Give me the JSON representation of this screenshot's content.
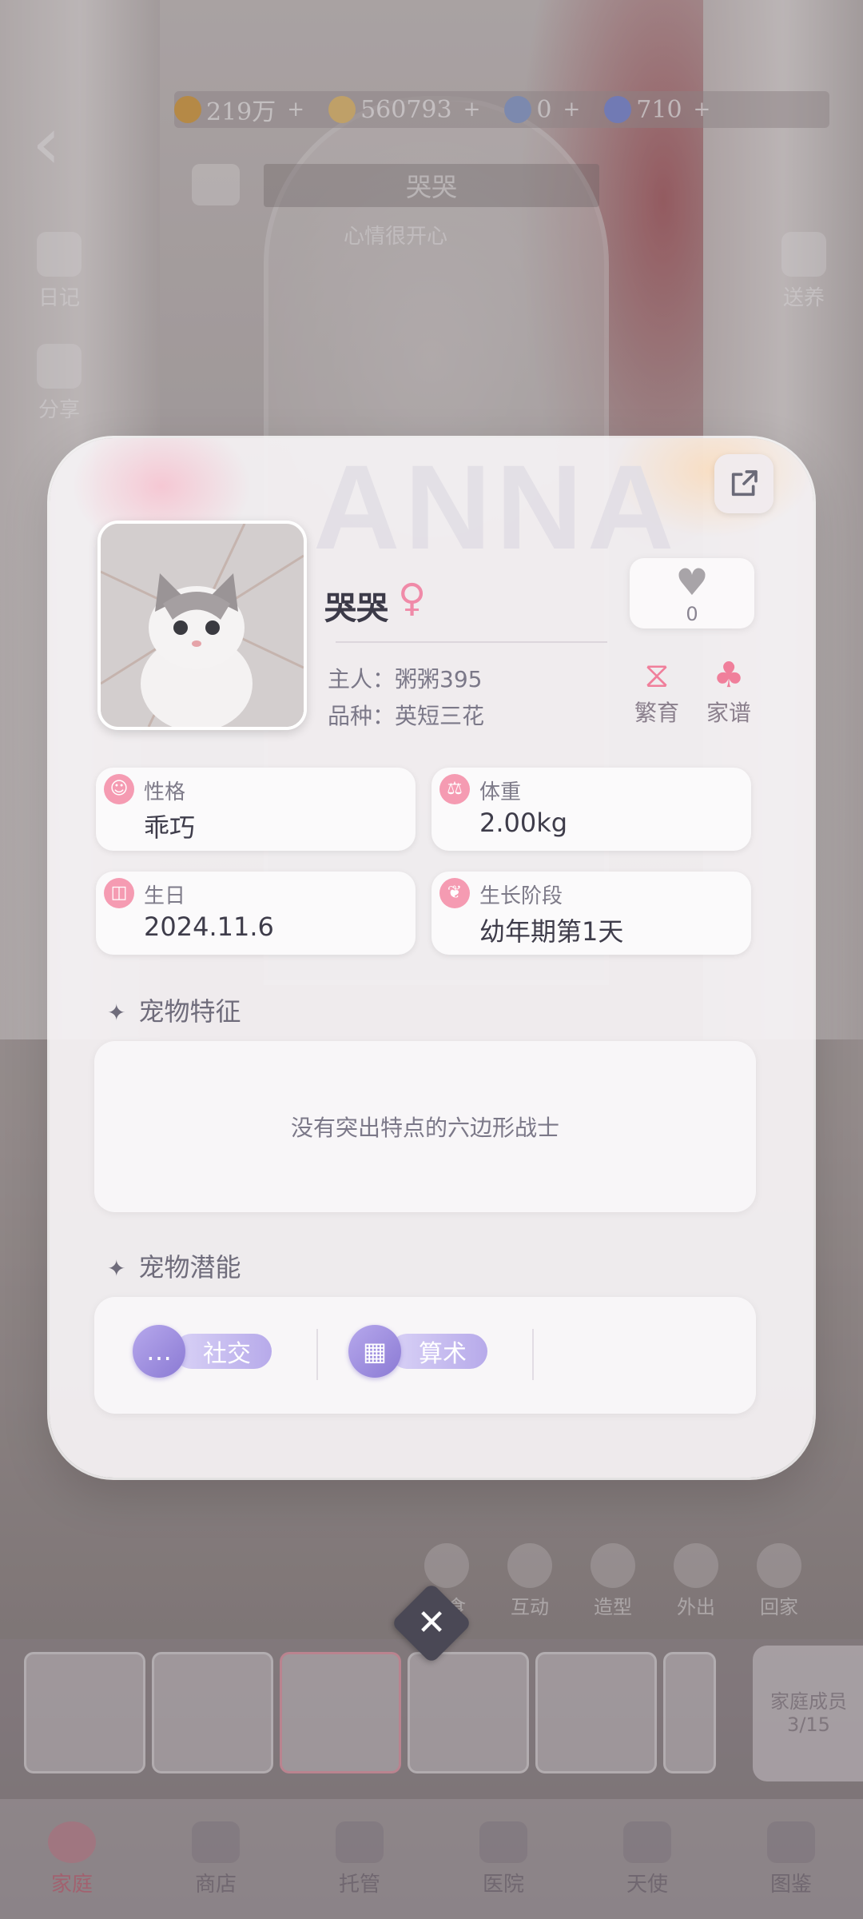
{
  "currency": [
    {
      "value": "219万",
      "icon": "gold-coin-icon",
      "color": "#d9a040"
    },
    {
      "value": "560793",
      "icon": "silver-coin-icon",
      "color": "#e6c070"
    },
    {
      "value": "0",
      "icon": "crystal-icon",
      "color": "#8aa0d0"
    },
    {
      "value": "710",
      "icon": "diamond-icon",
      "color": "#7b8bd8"
    }
  ],
  "background": {
    "pet_name": "哭哭",
    "mood_text": "心情很开心",
    "side_left": [
      "日记",
      "分享"
    ],
    "side_right": [
      "送养"
    ]
  },
  "card": {
    "watermark": "ANNA",
    "pet_name": "哭哭",
    "gender_symbol": "♀",
    "owner": "主人：粥粥395",
    "breed": "品种：英短三花",
    "likes": "0",
    "actions": [
      {
        "label": "繁育",
        "icon": "breeding-icon"
      },
      {
        "label": "家谱",
        "icon": "family-tree-icon"
      }
    ],
    "stats": [
      {
        "label": "性格",
        "value": "乖巧",
        "icon": "personality-icon"
      },
      {
        "label": "体重",
        "value": "2.00kg",
        "icon": "weight-icon"
      },
      {
        "label": "生日",
        "value": "2024.11.6",
        "icon": "birthday-cake-icon"
      },
      {
        "label": "生长阶段",
        "value": "幼年期第1天",
        "icon": "growth-leaf-icon"
      }
    ],
    "features_title": "宠物特征",
    "features_text": "没有突出特点的六边形战士",
    "potential_title": "宠物潜能",
    "potentials": [
      {
        "label": "社交",
        "icon": "chat-bubble-icon"
      },
      {
        "label": "算术",
        "icon": "calculator-icon"
      }
    ]
  },
  "quickbar": [
    "喂食",
    "互动",
    "造型",
    "外出",
    "回家"
  ],
  "family_count": {
    "label": "家庭成员",
    "value": "3/15"
  },
  "tabs": [
    "家庭",
    "商店",
    "托管",
    "医院",
    "天使",
    "图鉴"
  ],
  "active_tab": "家庭"
}
